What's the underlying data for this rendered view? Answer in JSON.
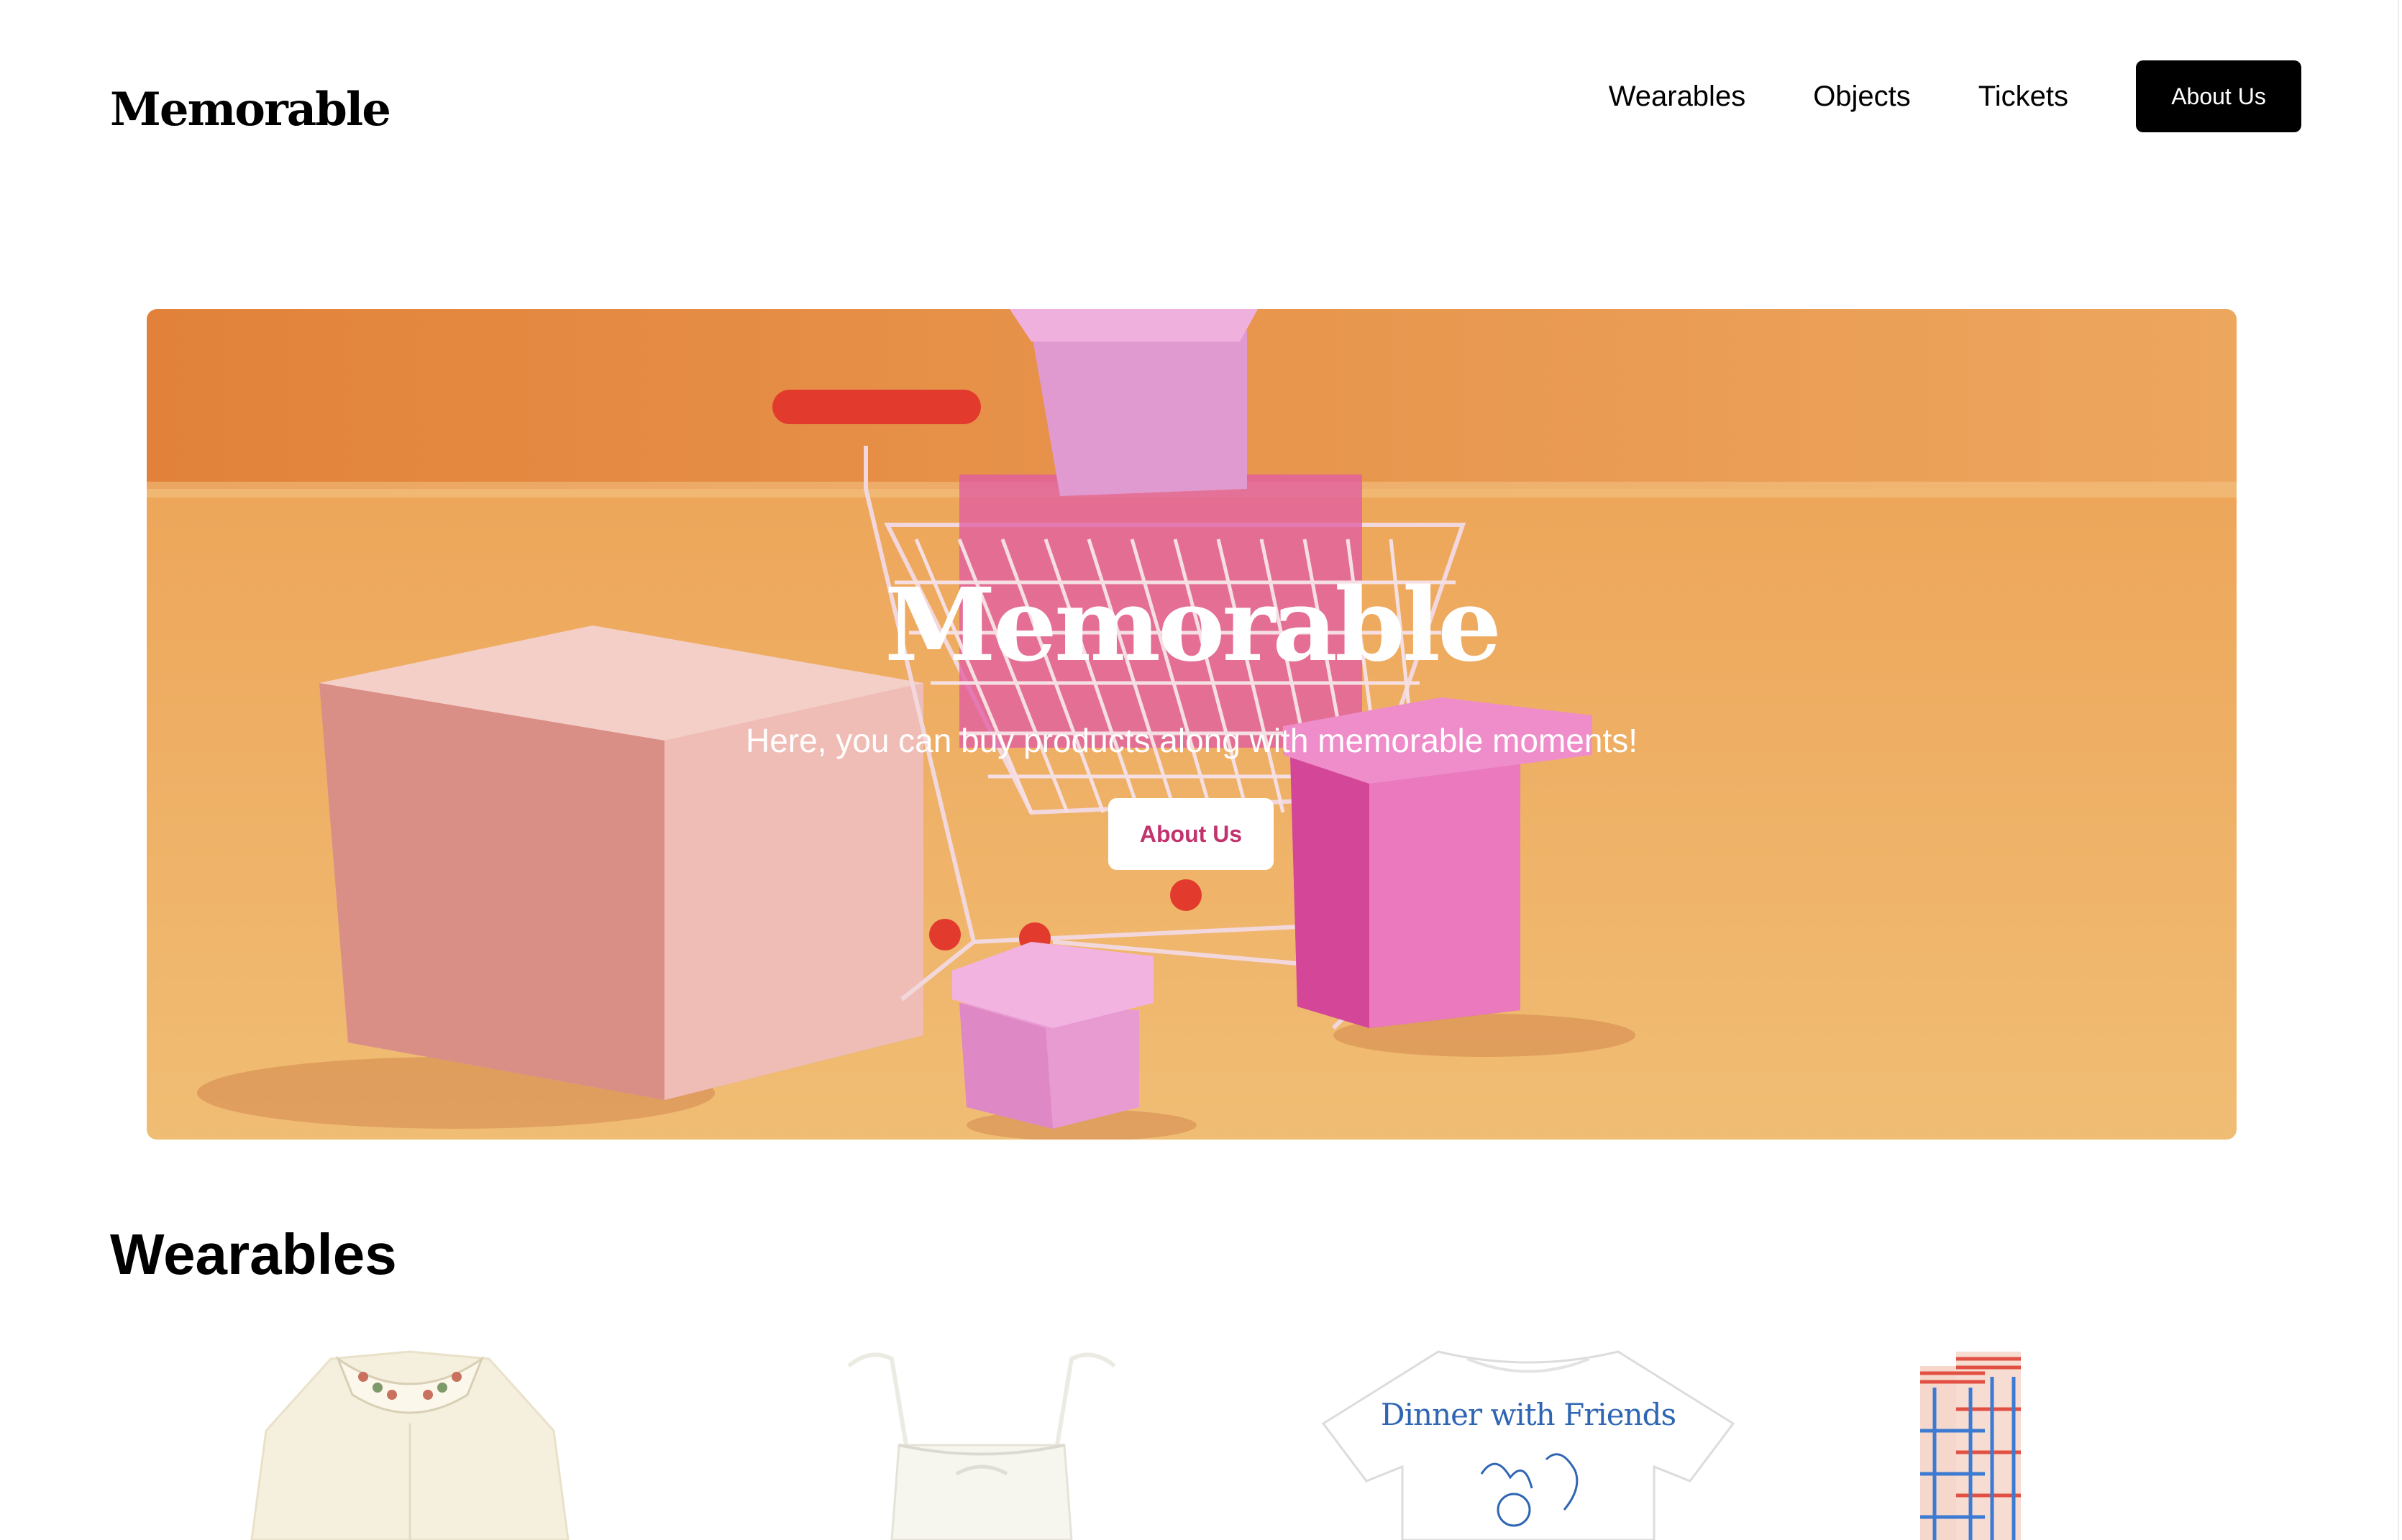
{
  "header": {
    "logo": "Memorable",
    "nav": [
      {
        "label": "Wearables"
      },
      {
        "label": "Objects"
      },
      {
        "label": "Tickets"
      }
    ],
    "cta_label": "About Us"
  },
  "hero": {
    "title": "Memorable",
    "subtitle": "Here, you can buy products along with memorable moments!",
    "cta_label": "About Us"
  },
  "wearables": {
    "title": "Wearables",
    "products": [
      {
        "name": "embroidered-collar-blouse"
      },
      {
        "name": "white-tie-strap-dress"
      },
      {
        "name": "dinner-with-friends-tshirt",
        "print_text": "Dinner with Friends"
      },
      {
        "name": "grid-socks"
      }
    ]
  },
  "colors": {
    "hero_orange": "#e8924a",
    "accent_pink": "#c2336d",
    "black": "#000000",
    "white": "#ffffff"
  }
}
